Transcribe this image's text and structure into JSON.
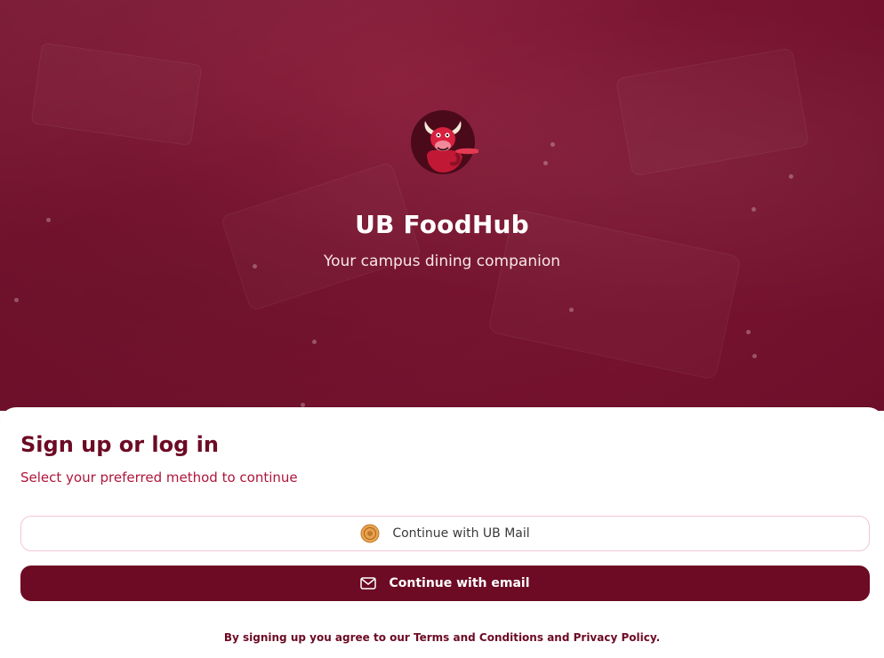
{
  "app": {
    "title": "UB FoodHub",
    "tagline": "Your campus dining companion",
    "logo_icon": "bull-mascot-icon"
  },
  "auth": {
    "heading": "Sign up or log in",
    "subheading": "Select your preferred method to continue",
    "ub_button_label": "Continue with UB Mail",
    "ub_button_icon": "ub-seal-icon",
    "email_button_label": "Continue with email",
    "email_button_icon": "mail-icon"
  },
  "legal": {
    "prefix": "By signing up you agree to our",
    "terms_label": "Terms and Conditions",
    "joiner": "and",
    "privacy_label": "Privacy Policy",
    "suffix": "."
  },
  "colors": {
    "brand": "#6d0a24",
    "hero_background": "#7a1531",
    "accent_text": "#b0153b",
    "ub_button_border": "#f2c8d2"
  }
}
